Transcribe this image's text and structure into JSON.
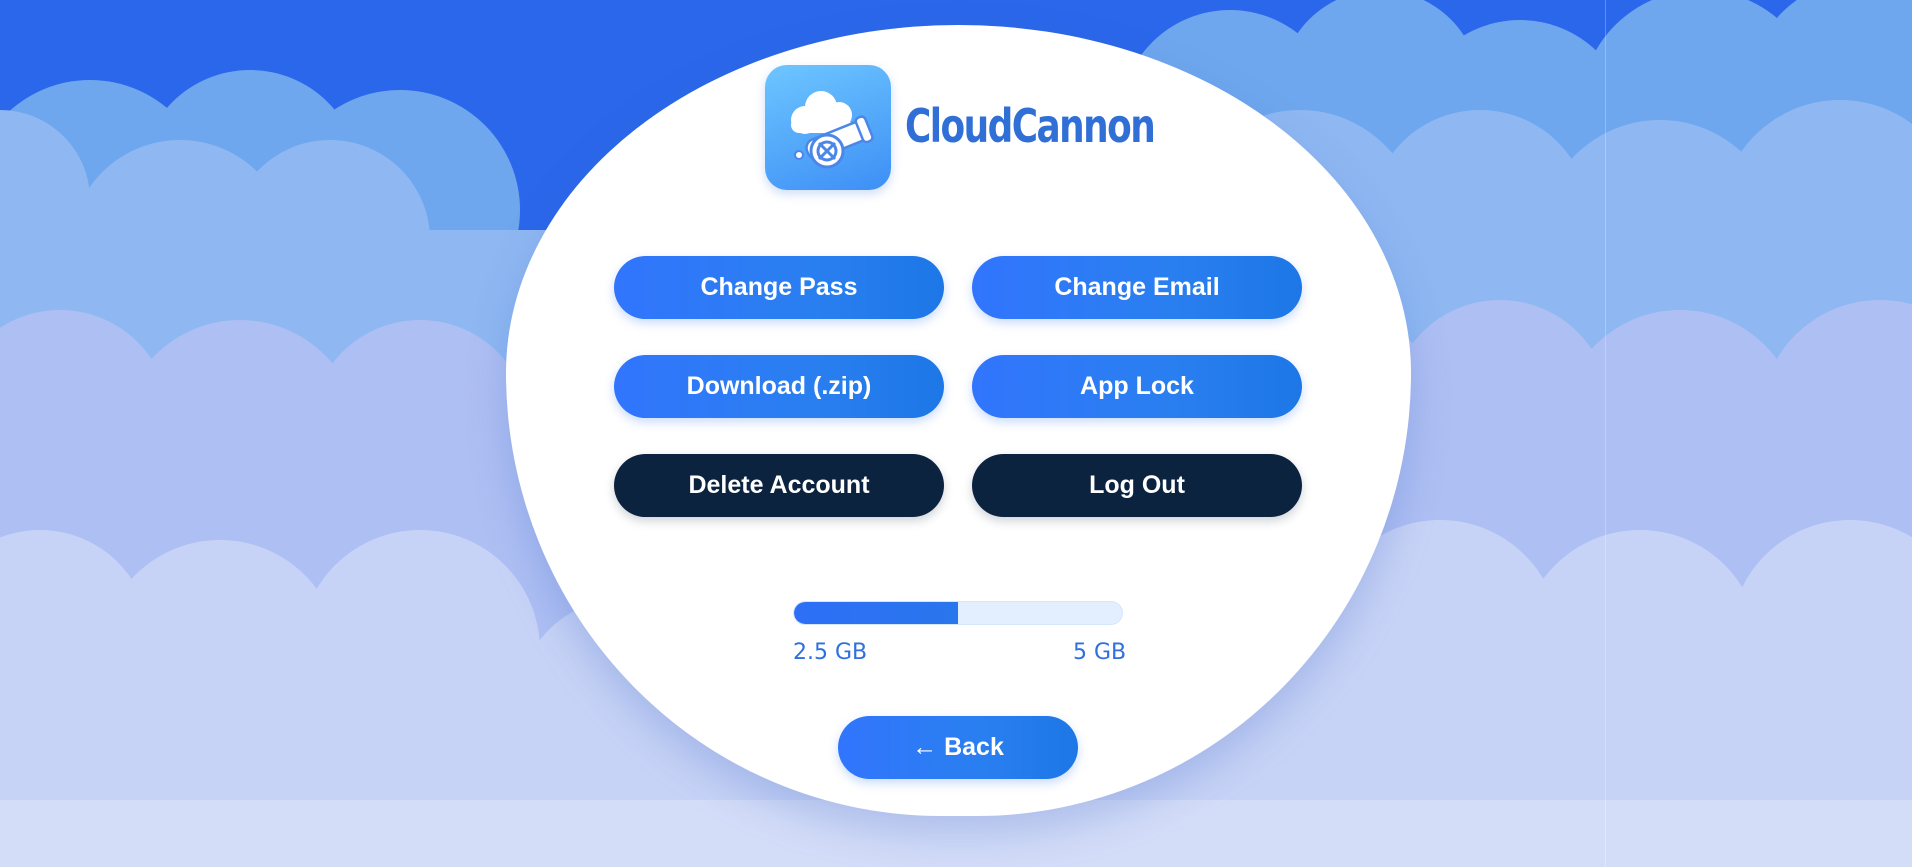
{
  "brand": {
    "name": "CloudCannon",
    "logo_icon": "cloud-cannon-logo-icon"
  },
  "actions": {
    "change_pass": "Change Pass",
    "change_email": "Change Email",
    "download_zip": "Download (.zip)",
    "app_lock": "App Lock",
    "delete_account": "Delete Account",
    "log_out": "Log Out"
  },
  "storage": {
    "used_label": "2.5 GB",
    "total_label": "5 GB",
    "used_fraction": 0.5
  },
  "navigation": {
    "back_label": "← Back"
  },
  "colors": {
    "accent_blue": "#3175fd",
    "dark_button": "#0c2340",
    "brand_text": "#2f6fd6",
    "background_blue": "#2b67ea"
  }
}
